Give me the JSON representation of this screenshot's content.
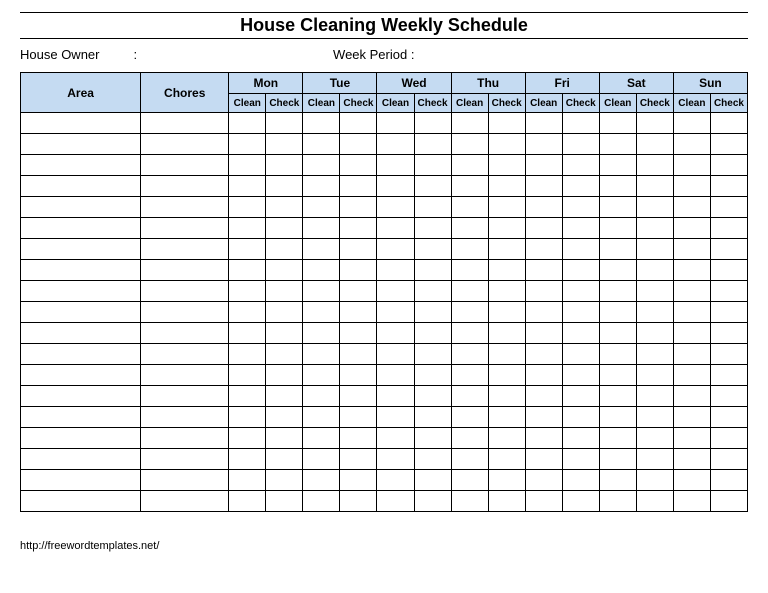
{
  "title": "House Cleaning Weekly Schedule",
  "meta": {
    "owner_label": "House Owner",
    "owner_value": "",
    "period_label": "Week  Period :",
    "period_value": ""
  },
  "columns": {
    "area": "Area",
    "chores": "Chores",
    "days": [
      "Mon",
      "Tue",
      "Wed",
      "Thu",
      "Fri",
      "Sat",
      "Sun"
    ],
    "sub": [
      "Clean",
      "Check"
    ]
  },
  "row_count": 19,
  "footer": "http://freewordtemplates.net/"
}
